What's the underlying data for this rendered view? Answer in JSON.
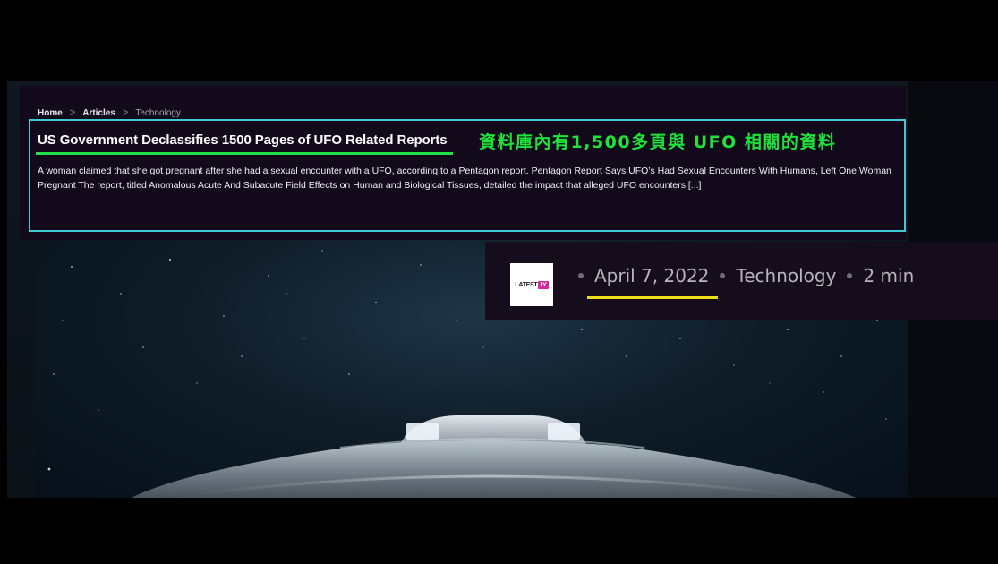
{
  "breadcrumb": {
    "home": "Home",
    "articles": "Articles",
    "current": "Technology",
    "separator": ">"
  },
  "article": {
    "title": "US Government Declassifies 1500 Pages of UFO Related Reports",
    "excerpt": "A woman claimed that she got pregnant after she had a sexual encounter with a UFO, according to a Pentagon report. Pentagon Report Says UFO’s Had Sexual Encounters With Humans, Left One Woman Pregnant The report, titled Anomalous Acute And Subacute Field Effects on Human and Biological Tissues, detailed the impact that alleged UFO encounters [...]"
  },
  "annotation": {
    "caption_zh": "資料庫內有1,500多頁與 UFO 相關的資料"
  },
  "meta": {
    "logo_text": "LATEST",
    "logo_badge": "LY",
    "date": "April 7, 2022",
    "category": "Technology",
    "read_time": "2 min"
  },
  "colors": {
    "highlight_box": "#3ec9d6",
    "title_underline": "#22e04a",
    "caption_zh": "#1fe23a",
    "date_underline": "#ecdc19",
    "card_bg": "#12091a"
  }
}
